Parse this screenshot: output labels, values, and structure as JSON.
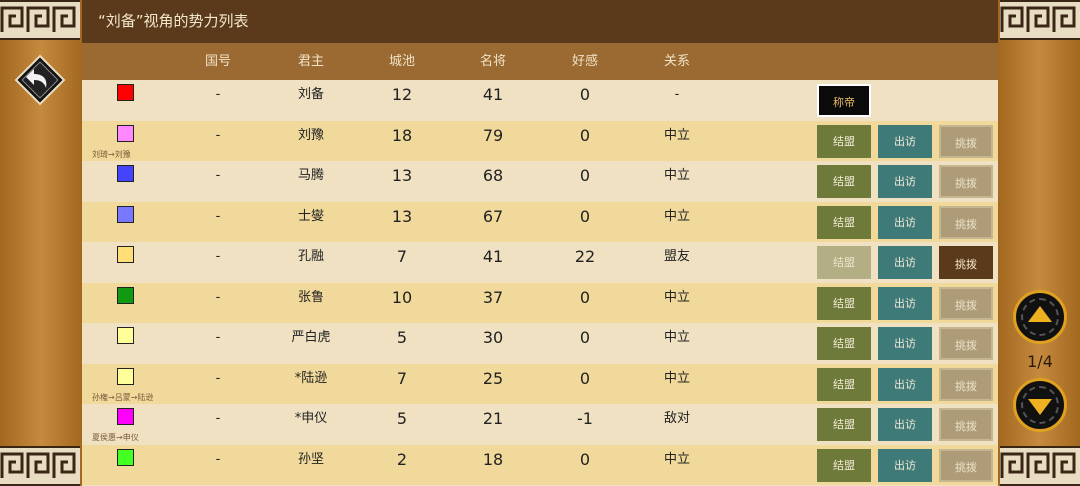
{
  "title": "“刘备”视角的势力列表",
  "columns": [
    "国号",
    "君主",
    "城池",
    "名将",
    "好感",
    "关系"
  ],
  "rows": [
    {
      "color": "#ff0000",
      "guohao": "-",
      "lord": "刘备",
      "cities": "12",
      "generals": "41",
      "favor": "0",
      "relation": "-",
      "note": "",
      "actions": "emperor"
    },
    {
      "color": "#ff88ff",
      "guohao": "-",
      "lord": "刘豫",
      "cities": "18",
      "generals": "79",
      "favor": "0",
      "relation": "中立",
      "note": "刘琦→刘豫",
      "actions": "normal"
    },
    {
      "color": "#4444ff",
      "guohao": "-",
      "lord": "马腾",
      "cities": "13",
      "generals": "68",
      "favor": "0",
      "relation": "中立",
      "note": "",
      "actions": "normal"
    },
    {
      "color": "#7777ff",
      "guohao": "-",
      "lord": "士燮",
      "cities": "13",
      "generals": "67",
      "favor": "0",
      "relation": "中立",
      "note": "",
      "actions": "normal"
    },
    {
      "color": "#ffdd77",
      "guohao": "-",
      "lord": "孔融",
      "cities": "7",
      "generals": "41",
      "favor": "22",
      "relation": "盟友",
      "note": "",
      "actions": "ally"
    },
    {
      "color": "#119911",
      "guohao": "-",
      "lord": "张鲁",
      "cities": "10",
      "generals": "37",
      "favor": "0",
      "relation": "中立",
      "note": "",
      "actions": "normal"
    },
    {
      "color": "#ffff99",
      "guohao": "-",
      "lord": "严白虎",
      "cities": "5",
      "generals": "30",
      "favor": "0",
      "relation": "中立",
      "note": "",
      "actions": "normal"
    },
    {
      "color": "#ffff99",
      "guohao": "-",
      "lord": "*陆逊",
      "cities": "7",
      "generals": "25",
      "favor": "0",
      "relation": "中立",
      "note": "孙権→吕蒙→陆逊",
      "actions": "normal"
    },
    {
      "color": "#ff00ff",
      "guohao": "-",
      "lord": "*申仪",
      "cities": "5",
      "generals": "21",
      "favor": "-1",
      "relation": "敌对",
      "note": "夏侯惠→申仪",
      "actions": "normal"
    },
    {
      "color": "#44ff22",
      "guohao": "-",
      "lord": "孙坚",
      "cities": "2",
      "generals": "18",
      "favor": "0",
      "relation": "中立",
      "note": "",
      "actions": "normal"
    }
  ],
  "buttons": {
    "emperor": "称帝",
    "ally": "结盟",
    "visit": "出访",
    "challenge": "挑拨"
  },
  "pager": {
    "text": "1/4"
  },
  "icons": {
    "back": "back-arrow-icon",
    "up": "up-arrow-icon",
    "down": "down-arrow-icon"
  }
}
